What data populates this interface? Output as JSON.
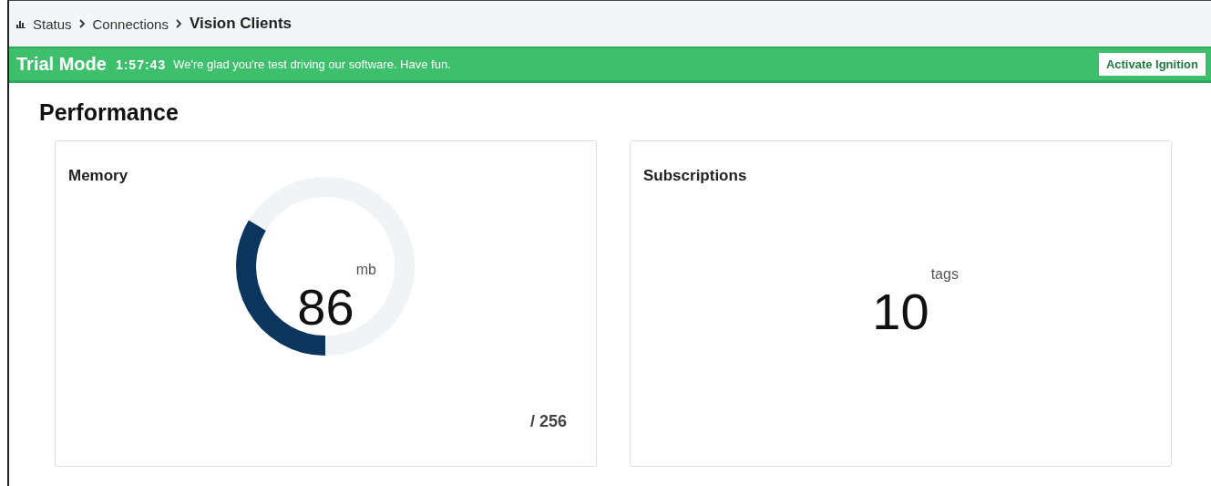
{
  "breadcrumb": [
    {
      "label": "Status",
      "current": false
    },
    {
      "label": "Connections",
      "current": false
    },
    {
      "label": "Vision Clients",
      "current": true
    }
  ],
  "trial_banner": {
    "title": "Trial Mode",
    "timer": "1:57:43",
    "message": "We're glad you're test driving our software. Have fun.",
    "button": "Activate Ignition"
  },
  "heading": "Performance",
  "cards": [
    {
      "kind": "gauge",
      "title": "Memory",
      "value": "86",
      "unit": "mb",
      "max": "/ 256"
    },
    {
      "kind": "count",
      "title": "Subscriptions",
      "value": "10",
      "unit": "tags"
    }
  ]
}
